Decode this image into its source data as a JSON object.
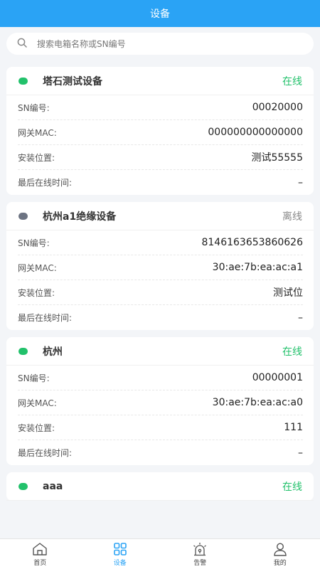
{
  "header": {
    "title": "设备"
  },
  "search": {
    "placeholder": "搜索电箱名称或SN编号",
    "icon": "search-icon"
  },
  "labels": {
    "sn": "SN编号:",
    "mac": "网关MAC:",
    "location": "安装位置:",
    "last_online": "最后在线时间:"
  },
  "devices": [
    {
      "name": "塔石测试设备",
      "status": "在线",
      "online": true,
      "sn": "00020000",
      "mac": "000000000000000",
      "location": "测试55555",
      "last_online": "–"
    },
    {
      "name": "杭州a1绝缘设备",
      "status": "离线",
      "online": false,
      "sn": "8146163653860626",
      "mac": "30:ae:7b:ea:ac:a1",
      "location": "测试位",
      "last_online": "–"
    },
    {
      "name": "杭州",
      "status": "在线",
      "online": true,
      "sn": "00000001",
      "mac": "30:ae:7b:ea:ac:a0",
      "location": "111",
      "last_online": "–"
    },
    {
      "name": "aaa",
      "status": "在线",
      "online": true
    }
  ],
  "tabbar": {
    "items": [
      {
        "label": "首页",
        "icon": "home-icon"
      },
      {
        "label": "设备",
        "icon": "grid-icon",
        "active": true
      },
      {
        "label": "告警",
        "icon": "alarm-icon"
      },
      {
        "label": "我的",
        "icon": "user-icon"
      }
    ]
  },
  "colors": {
    "accent": "#2aa3f5",
    "online": "#22c16b",
    "offline": "#6c7382",
    "background": "#f3f5f8"
  }
}
